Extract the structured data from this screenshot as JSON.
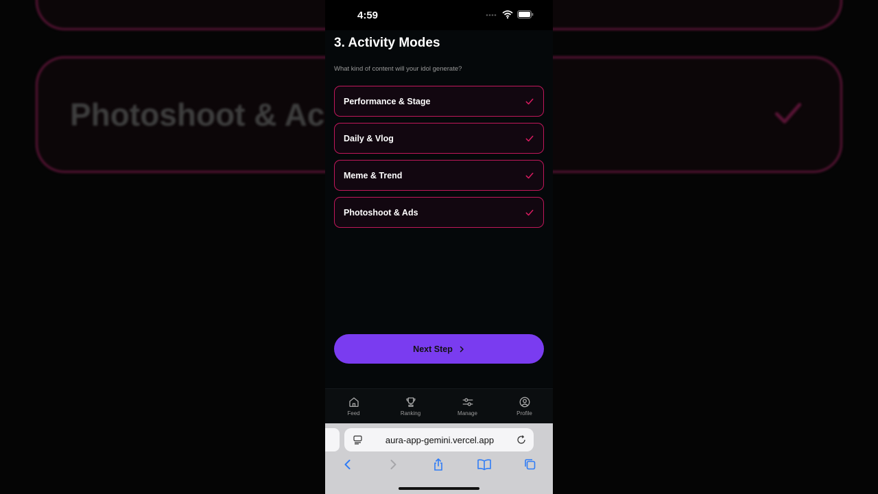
{
  "background": {
    "echo_text": "Photoshoot & Ac"
  },
  "status_bar": {
    "time": "4:59"
  },
  "step": {
    "title": "3. Activity Modes",
    "subtitle": "What kind of content will your idol generate?",
    "options": [
      {
        "label": "Performance & Stage",
        "selected": true
      },
      {
        "label": "Daily & Vlog",
        "selected": true
      },
      {
        "label": "Meme & Trend",
        "selected": true
      },
      {
        "label": "Photoshoot & Ads",
        "selected": true
      }
    ],
    "next_button": "Next Step"
  },
  "tab_bar": {
    "items": [
      {
        "label": "Feed",
        "icon": "home-icon"
      },
      {
        "label": "Ranking",
        "icon": "trophy-icon"
      },
      {
        "label": "Manage",
        "icon": "sliders-icon"
      },
      {
        "label": "Profile",
        "icon": "user-circle-icon"
      }
    ]
  },
  "browser": {
    "url": "aura-app-gemini.vercel.app"
  },
  "colors": {
    "accent": "#c2185b",
    "button": "#7a3cf0",
    "background": "#05080a"
  }
}
